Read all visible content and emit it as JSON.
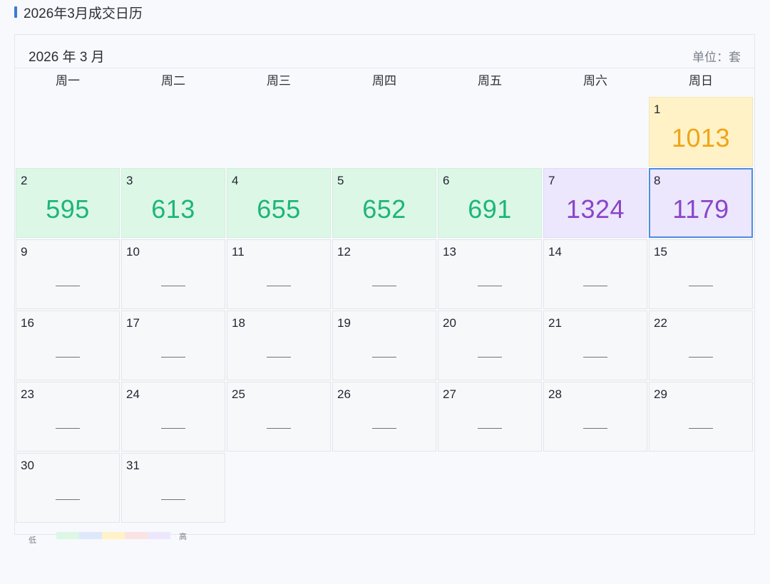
{
  "page_title": "2026年3月成交日历",
  "calendar": {
    "month_label": "2026 年 3 月",
    "unit_label": "单位：套",
    "weekdays": [
      "周一",
      "周二",
      "周三",
      "周四",
      "周五",
      "周六",
      "周日"
    ],
    "empty_placeholder": "——",
    "days": [
      {
        "day": "1",
        "value": "1013",
        "level": "yellow"
      },
      {
        "day": "2",
        "value": "595",
        "level": "green"
      },
      {
        "day": "3",
        "value": "613",
        "level": "green"
      },
      {
        "day": "4",
        "value": "655",
        "level": "green"
      },
      {
        "day": "5",
        "value": "652",
        "level": "green"
      },
      {
        "day": "6",
        "value": "691",
        "level": "green"
      },
      {
        "day": "7",
        "value": "1324",
        "level": "purple"
      },
      {
        "day": "8",
        "value": "1179",
        "level": "purple",
        "today": true
      },
      {
        "day": "9"
      },
      {
        "day": "10"
      },
      {
        "day": "11"
      },
      {
        "day": "12"
      },
      {
        "day": "13"
      },
      {
        "day": "14"
      },
      {
        "day": "15"
      },
      {
        "day": "16"
      },
      {
        "day": "17"
      },
      {
        "day": "18"
      },
      {
        "day": "19"
      },
      {
        "day": "20"
      },
      {
        "day": "21"
      },
      {
        "day": "22"
      },
      {
        "day": "23"
      },
      {
        "day": "24"
      },
      {
        "day": "25"
      },
      {
        "day": "26"
      },
      {
        "day": "27"
      },
      {
        "day": "28"
      },
      {
        "day": "29"
      },
      {
        "day": "30"
      },
      {
        "day": "31"
      }
    ]
  },
  "legend": {
    "low_label": "低",
    "high_label": "高",
    "colors": [
      "#dcf7e6",
      "#dde9fb",
      "#fff2c6",
      "#fbe2e3",
      "#ece7fc"
    ]
  },
  "level_colors": {
    "green": "#1db57b",
    "yellow": "#efa419",
    "purple": "#8a45c9",
    "accent": "#3a7bd5"
  }
}
